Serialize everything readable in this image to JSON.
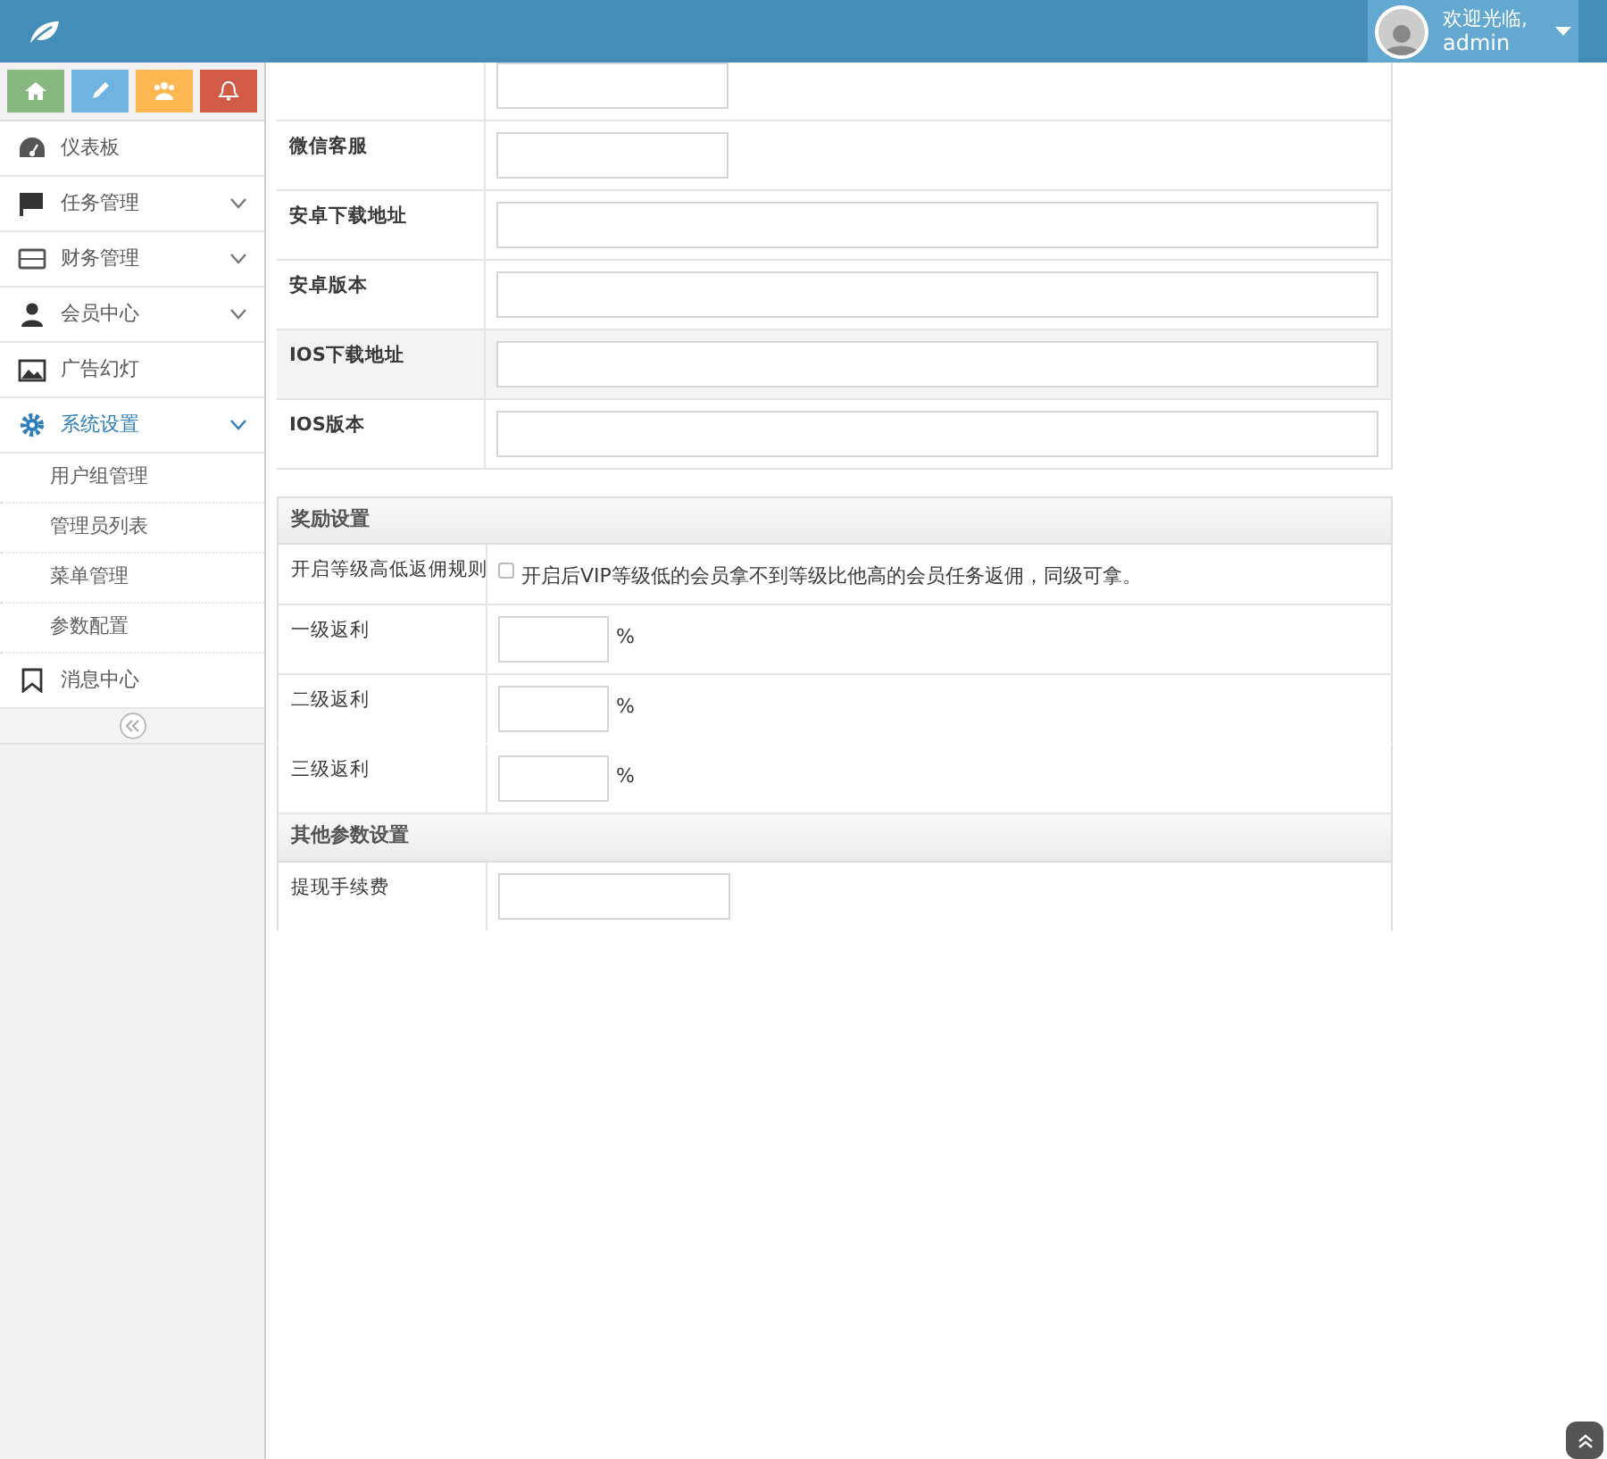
{
  "navbar": {
    "welcome": "欢迎光临,",
    "user": "admin"
  },
  "sidebar": {
    "items": [
      {
        "label": "仪表板",
        "has_children": false,
        "expanded": false
      },
      {
        "label": "任务管理",
        "has_children": true,
        "expanded": false
      },
      {
        "label": "财务管理",
        "has_children": true,
        "expanded": false
      },
      {
        "label": "会员中心",
        "has_children": true,
        "expanded": false
      },
      {
        "label": "广告幻灯",
        "has_children": false,
        "expanded": false
      },
      {
        "label": "系统设置",
        "has_children": true,
        "expanded": true,
        "children": [
          {
            "label": "用户组管理"
          },
          {
            "label": "管理员列表"
          },
          {
            "label": "菜单管理"
          },
          {
            "label": "参数配置"
          }
        ]
      },
      {
        "label": "消息中心",
        "has_children": false,
        "expanded": false
      }
    ]
  },
  "form": {
    "rows": [
      {
        "kind": "short",
        "highlighted": false
      },
      {
        "kind": "short",
        "label": "微信客服",
        "highlighted": false
      },
      {
        "kind": "long",
        "label": "安卓下载地址",
        "highlighted": false
      },
      {
        "kind": "long",
        "label": "安卓版本",
        "highlighted": false
      },
      {
        "kind": "long",
        "label": "IOS下载地址",
        "highlighted": true
      },
      {
        "kind": "long",
        "label": "IOS版本",
        "highlighted": false
      }
    ]
  },
  "sections": [
    {
      "title": "奖励设置",
      "rows": [
        {
          "kind": "checkbox",
          "label": "开启等级高低返佣规则",
          "checked": false,
          "text": "开启后VIP等级低的会员拿不到等级比他高的会员任务返佣，同级可拿。",
          "divider": true
        },
        {
          "kind": "percent",
          "label": "一级返利",
          "unit": "%",
          "divider": true
        },
        {
          "kind": "percent",
          "label": "二级返利",
          "unit": "%",
          "divider": false
        },
        {
          "kind": "percent",
          "label": "三级返利",
          "unit": "%",
          "divider": true
        }
      ]
    },
    {
      "title": "其他参数设置",
      "rows": [
        {
          "kind": "short",
          "label": "提现手续费"
        }
      ]
    }
  ]
}
